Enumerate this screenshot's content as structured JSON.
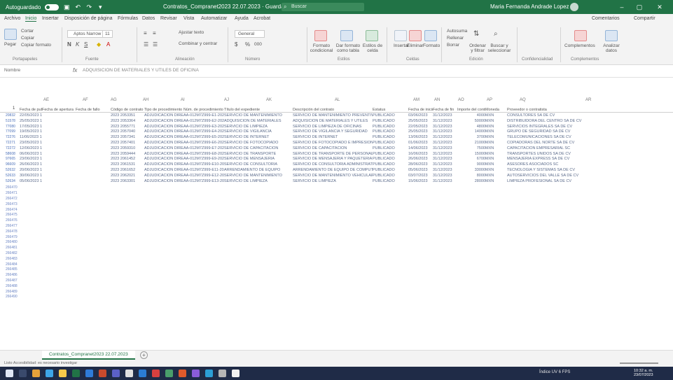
{
  "titlebar": {
    "autosave_label": "Autoguardado",
    "file_title": "Contratos_Compranet2023 22.07.2023",
    "status": "Guardando...",
    "search_placeholder": "Buscar",
    "user": "Maria Fernanda Andrade Lopez",
    "minimize": "–",
    "restore": "▢",
    "close": "✕"
  },
  "tabs": [
    "Archivo",
    "Inicio",
    "Insertar",
    "Disposición de página",
    "Fórmulas",
    "Datos",
    "Revisar",
    "Vista",
    "Automatizar",
    "Ayuda",
    "Acrobat"
  ],
  "tabs_active": "Inicio",
  "tabs_right": [
    "Comentarios",
    "Compartir"
  ],
  "ribbon": {
    "groups": [
      "Portapapeles",
      "Fuente",
      "Alineación",
      "Número",
      "Estilos",
      "Celdas",
      "Edición",
      "Confidencialidad",
      "Complementos"
    ],
    "clipboard": {
      "paste": "Pegar",
      "cut": "Cortar",
      "copy": "Copiar",
      "format_painter": "Copiar formato"
    },
    "font": {
      "font_name": "Aptos Narrow",
      "font_size": "11",
      "bold": "N",
      "italic": "K",
      "underline": "S"
    },
    "alignment": {
      "wrap": "Ajustar texto",
      "merge": "Combinar y centrar"
    },
    "number": {
      "format": "General",
      "currency": "$",
      "percent": "%",
      "thousands": "000"
    },
    "styles": {
      "conditional": "Formato condicional",
      "table": "Dar formato como tabla",
      "cell_styles": "Estilos de celda"
    },
    "cells": {
      "insert": "Insertar",
      "delete": "Eliminar",
      "format": "Formato"
    },
    "editing": {
      "autosum": "Autosuma",
      "fill": "Rellenar",
      "clear": "Borrar",
      "sort": "Ordenar y filtrar",
      "find": "Buscar y seleccionar"
    },
    "addins": {
      "addins": "Complementos",
      "analyze": "Analizar datos"
    }
  },
  "formula_bar": {
    "name_box": "Nombre",
    "fx": "fx",
    "content": "ADQUISICION DE MATERIALES Y UTILES DE OFICINA"
  },
  "columns": [
    "AE",
    "AF",
    "AG",
    "AH",
    "AI",
    "AJ",
    "AK",
    "AL",
    "AM",
    "AN",
    "AO",
    "AP",
    "AQ",
    "AR"
  ],
  "header_row": {
    "row_number": "1",
    "cells": [
      "Fecha de publicación",
      "Fecha de apertura",
      "Fecha de fallo",
      "Código de contrato",
      "Tipo de procedimiento",
      "Núm. de procedimiento",
      "Título del expediente",
      "Descripción del contrato",
      "Estatus",
      "Fecha de inicio",
      "Fecha de fin",
      "Importe del contrato",
      "Moneda",
      "Proveedor o contratista"
    ]
  },
  "data_rows": [
    {
      "rn": "20832",
      "cells": [
        "22/05/2023 14:43",
        "",
        "",
        "2023 2053351",
        "ADJUDICACION DIRECTA",
        "AA-012M7Z999-E1-2023",
        "SERVICIO DE MANTENIMIENTO",
        "SERVICIO DE MANTENIMIENTO PREVENTIVO",
        "PUBLICADO",
        "03/06/2023",
        "31/12/2023",
        "4000",
        "MXN",
        "CONSULTORES SA DE CV"
      ]
    },
    {
      "rn": "51578",
      "cells": [
        "25/05/2023 15:17",
        "",
        "",
        "2023 2053364",
        "ADJUDICACION DIRECTA",
        "AA-012M7Z999-E2-2023",
        "ADQUISICION DE MATERIALES",
        "ADQUISICION DE MATERIALES Y UTILES",
        "PUBLICADO",
        "25/05/2023",
        "31/12/2023",
        "50000",
        "MXN",
        "DISTRIBUIDORA DEL CENTRO SA DE CV"
      ]
    },
    {
      "rn": "77080",
      "cells": [
        "17/05/2023 16:27",
        "",
        "",
        "2023 2055771",
        "ADJUDICACION DIRECTA",
        "AA-012M7Z999-E3-2023",
        "SERVICIO DE LIMPIEZA",
        "SERVICIO DE LIMPIEZA DE OFICINAS",
        "PUBLICADO",
        "22/05/2023",
        "31/12/2023",
        "4800",
        "MXN",
        "SERVICIOS INTEGRALES SA DE CV"
      ]
    },
    {
      "rn": "77099",
      "cells": [
        "19/05/2023 16:12",
        "",
        "",
        "2023 2057040",
        "ADJUDICACION DIRECTA",
        "AA-012M7Z999-E4-2023",
        "SERVICIO DE VIGILANCIA",
        "SERVICIO DE VIGILANCIA Y SEGURIDAD",
        "PUBLICADO",
        "25/05/2023",
        "31/12/2023",
        "14000",
        "MXN",
        "GRUPO DE SEGURIDAD SA DE CV"
      ]
    },
    {
      "rn": "72276",
      "cells": [
        "11/06/2023 16:05",
        "",
        "",
        "2023 2057341",
        "ADJUDICACION DIRECTA",
        "AA-012M7Z999-E5-2023",
        "SERVICIO DE INTERNET",
        "SERVICIO DE INTERNET",
        "PUBLICADO",
        "13/06/2023",
        "31/12/2023",
        "3700",
        "MXN",
        "TELECOMUNICACIONES SA DE CV"
      ]
    },
    {
      "rn": "72271",
      "cells": [
        "23/05/2023 16:35",
        "",
        "",
        "2023 2057401",
        "ADJUDICACION DIRECTA",
        "AA-012M7Z999-E6-2023",
        "SERVICIO DE FOTOCOPIADO",
        "SERVICIO DE FOTOCOPIADO E IMPRESION",
        "PUBLICADO",
        "01/06/2023",
        "31/12/2023",
        "21000",
        "MXN",
        "COPIADORAS DEL NORTE SA DE CV"
      ]
    },
    {
      "rn": "72272",
      "cells": [
        "12/06/2023 17:26",
        "",
        "",
        "2023 2059310",
        "ADJUDICACION DIRECTA",
        "AA-012M7Z999-E7-2023",
        "SERVICIO DE CAPACITACION",
        "SERVICIO DE CAPACITACION",
        "PUBLICADO",
        "14/06/2023",
        "31/12/2023",
        "7500",
        "MXN",
        "CAPACITACION EMPRESARIAL SC"
      ]
    },
    {
      "rn": "58608",
      "cells": [
        "06/06/2023 17:34",
        "",
        "",
        "2023 2059444",
        "ADJUDICACION DIRECTA",
        "AA-012M7Z999-E8-2023",
        "SERVICIO DE TRANSPORTE",
        "SERVICIO DE TRANSPORTE DE PERSONAL",
        "PUBLICADO",
        "16/06/2023",
        "31/12/2023",
        "15000",
        "MXN",
        "TRANSPORTES UNIDOS SA DE CV"
      ]
    },
    {
      "rn": "97665",
      "cells": [
        "23/06/2023 14:54",
        "",
        "",
        "2023 2061452",
        "ADJUDICACION DIRECTA",
        "AA-012M7Z999-E9-2023",
        "SERVICIO DE MENSAJERIA",
        "SERVICIO DE MENSAJERIA Y PAQUETERIA",
        "PUBLICADO",
        "26/06/2023",
        "31/12/2023",
        "6700",
        "MXN",
        "MENSAJERIA EXPRESS SA DE CV"
      ]
    },
    {
      "rn": "96609",
      "cells": [
        "26/06/2023 15:06",
        "",
        "",
        "2023 2061531",
        "ADJUDICACION DIRECTA",
        "AA-012M7Z999-E10-2023",
        "SERVICIO DE CONSULTORIA",
        "SERVICIO DE CONSULTORIA ADMINISTRATIVA",
        "PUBLICADO",
        "28/06/2023",
        "31/12/2023",
        "9000",
        "MXN",
        "ASESORES ASOCIADOS SC"
      ]
    },
    {
      "rn": "52632",
      "cells": [
        "20/06/2023 12:17",
        "",
        "",
        "2023 2061652",
        "ADJUDICACION DIRECTA",
        "AA-012M7Z999-E11-2023",
        "ARRENDAMIENTO DE EQUIPO",
        "ARRENDAMIENTO DE EQUIPO DE COMPUTO",
        "PUBLICADO",
        "05/06/2023",
        "31/12/2023",
        "33000",
        "MXN",
        "TECNOLOGIA Y SISTEMAS SA DE CV"
      ]
    },
    {
      "rn": "52633",
      "cells": [
        "30/06/2023 14:31",
        "",
        "",
        "2023 2062021",
        "ADJUDICACION DIRECTA",
        "AA-012M7Z999-E12-2023",
        "SERVICIO DE MANTENIMIENTO",
        "SERVICIO DE MANTENIMIENTO VEHICULAR",
        "PUBLICADO",
        "03/07/2023",
        "31/12/2023",
        "8000",
        "MXN",
        "AUTOSERVICIOS DEL VALLE SA DE CV"
      ]
    },
    {
      "rn": "52634",
      "cells": [
        "05/06/2023 15:11",
        "",
        "",
        "2023 2063301",
        "ADJUDICACION DIRECTA",
        "AA-012M7Z999-E13-2023",
        "SERVICIO DE LIMPIEZA",
        "SERVICIO DE LIMPIEZA",
        "PUBLICADO",
        "15/06/2023",
        "31/12/2023",
        "28000",
        "MXN",
        "LIMPIEZA PROFESIONAL SA DE CV"
      ]
    }
  ],
  "empty_rows": [
    "266470",
    "266471",
    "266472",
    "266473",
    "266474",
    "266475",
    "266476",
    "266477",
    "266478",
    "266479",
    "266480",
    "266481",
    "266482",
    "266483",
    "266484",
    "266485",
    "266486",
    "266487",
    "266488",
    "266489",
    "266490"
  ],
  "sheet_tab": "Contratos_Compranet2023 22.07.2023",
  "add_sheet": "+",
  "status": "Listo    Accesibilidad: es necesario investigar",
  "taskbar": {
    "tray": "Índice UV 6 FPS",
    "time": "10:32 a. m.",
    "date": "23/07/2023"
  }
}
